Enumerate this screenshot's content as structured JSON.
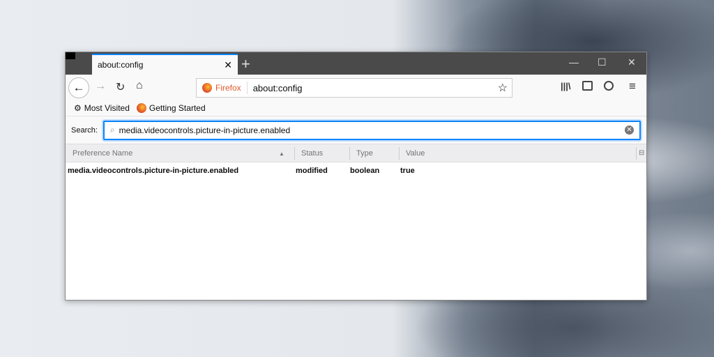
{
  "tab": {
    "title": "about:config",
    "close": "✕",
    "new": "+"
  },
  "window": {
    "minimize": "—",
    "maximize": "☐",
    "close": "✕"
  },
  "nav": {
    "identity": "Firefox",
    "url": "about:config"
  },
  "bookmarks": [
    {
      "label": "Most Visited"
    },
    {
      "label": "Getting Started"
    }
  ],
  "search": {
    "label": "Search:",
    "value": "media.videocontrols.picture-in-picture.enabled"
  },
  "columns": [
    "Preference Name",
    "Status",
    "Type",
    "Value"
  ],
  "rows": [
    {
      "name": "media.videocontrols.picture-in-picture.enabled",
      "status": "modified",
      "type": "boolean",
      "value": "true"
    }
  ]
}
